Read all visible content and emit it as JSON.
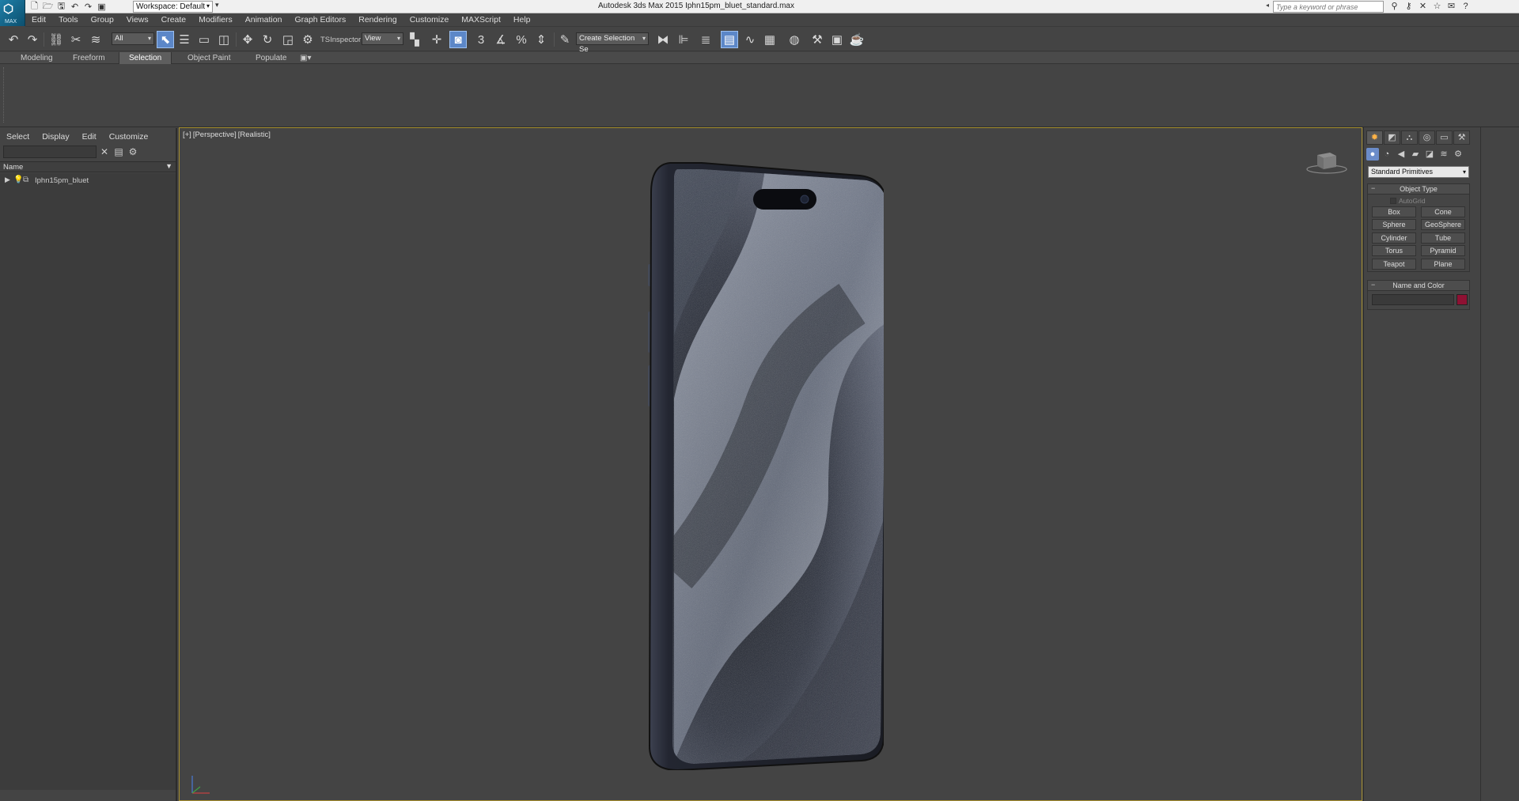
{
  "window": {
    "app_logo": "MAX",
    "title": "Autodesk 3ds Max  2015     Iphn15pm_bluet_standard.max",
    "workspace_label": "Workspace: Default",
    "search_placeholder": "Type a keyword or phrase"
  },
  "menu": [
    "Edit",
    "Tools",
    "Group",
    "Views",
    "Create",
    "Modifiers",
    "Animation",
    "Graph Editors",
    "Rendering",
    "Customize",
    "MAXScript",
    "Help"
  ],
  "toolbar": {
    "selection_filter": "All",
    "ts_inspector": "TSInspector",
    "ref_coord": "View",
    "snap_3": "3",
    "selection_set_placeholder": "Create Selection Se"
  },
  "ribbon": {
    "tabs": [
      "Modeling",
      "Freeform",
      "Selection",
      "Object Paint",
      "Populate"
    ],
    "active_tab": "Selection"
  },
  "scene_explorer": {
    "menu": [
      "Select",
      "Display",
      "Edit",
      "Customize"
    ],
    "column_header": "Name",
    "items": [
      {
        "name": "Iphn15pm_bluet"
      }
    ]
  },
  "viewport": {
    "labels": [
      "[+]",
      "[Perspective]",
      "[Realistic]"
    ]
  },
  "command_panel": {
    "category": "Standard Primitives",
    "object_type_title": "Object Type",
    "autogrid_label": "AutoGrid",
    "primitives": [
      "Box",
      "Cone",
      "Sphere",
      "GeoSphere",
      "Cylinder",
      "Tube",
      "Torus",
      "Pyramid",
      "Teapot",
      "Plane"
    ],
    "name_color_title": "Name and Color",
    "object_color": "#8e1133"
  }
}
